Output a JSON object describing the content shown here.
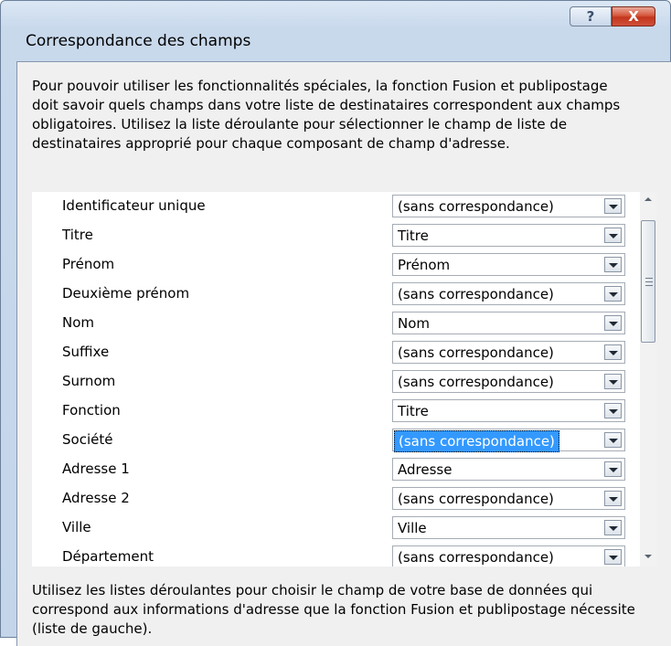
{
  "window": {
    "title": "Correspondance des champs",
    "help_label": "?",
    "close_label": "X"
  },
  "intro_text": "Pour pouvoir utiliser les fonctionnalités spéciales, la fonction Fusion et publipostage doit savoir quels champs dans votre liste de destinataires correspondent aux champs obligatoires. Utilisez la liste déroulante pour sélectionner le champ de liste de destinataires approprié pour chaque composant de champ d'adresse.",
  "fields": [
    {
      "label": "Identificateur unique",
      "value": "(sans correspondance)"
    },
    {
      "label": "Titre",
      "value": "Titre"
    },
    {
      "label": "Prénom",
      "value": "Prénom"
    },
    {
      "label": "Deuxième prénom",
      "value": "(sans correspondance)"
    },
    {
      "label": "Nom",
      "value": "Nom"
    },
    {
      "label": "Suffixe",
      "value": "(sans correspondance)"
    },
    {
      "label": "Surnom",
      "value": "(sans correspondance)"
    },
    {
      "label": "Fonction",
      "value": "Titre"
    },
    {
      "label": "Société",
      "value": "(sans correspondance)",
      "selected": true
    },
    {
      "label": "Adresse 1",
      "value": "Adresse"
    },
    {
      "label": "Adresse 2",
      "value": "(sans correspondance)"
    },
    {
      "label": "Ville",
      "value": "Ville"
    },
    {
      "label": "Département",
      "value": "(sans correspondance)"
    }
  ],
  "footer_text": "Utilisez les listes déroulantes pour choisir le champ de votre base de données qui correspond aux informations d'adresse que la fonction Fusion et publipostage nécessite (liste de gauche).",
  "colors": {
    "selection": "#3399ff",
    "close_button": "#c2361c",
    "dialog_background": "#f0f0f0"
  }
}
